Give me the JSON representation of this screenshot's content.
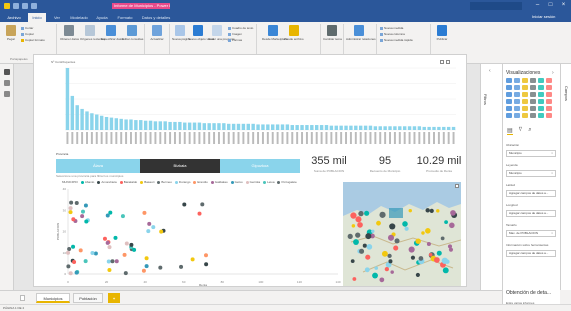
{
  "window": {
    "title": "Informe de Municipios - Power BI Desktop"
  },
  "ribbon_tabs": [
    {
      "label": "Archivo"
    },
    {
      "label": "Inicio"
    },
    {
      "label": "Ver"
    },
    {
      "label": "Modelado"
    },
    {
      "label": "Ayuda"
    },
    {
      "label": "Formato"
    },
    {
      "label": "Datos y detalles"
    }
  ],
  "signin": "Iniciar sesión",
  "ribbon": {
    "pegar": "Pegar",
    "cortar": "Cortar",
    "copiar": "Copiar",
    "copiar_formato": "Copiar formato",
    "obtener_datos": "Obtener datos",
    "origenes_recientes": "Orígenes recientes",
    "especificar_datos": "Especificar datos",
    "editar_consultas": "Editar consultas",
    "actualizar": "Actualizar",
    "nueva_pagina": "Nueva página",
    "nuevo_objeto": "Nuevo objeto visual",
    "hacer_pregunta": "Hacer una pregunta",
    "cuadro_texto": "Cuadro de texto",
    "imagen": "Imagen",
    "formas": "Formas",
    "desde_marketplace": "Desde Marketplace",
    "desde_archivo": "Desde archivo",
    "cambiar_tema": "Cambiar tema",
    "administrar_relaciones": "Administrar relaciones",
    "nueva_medida": "Nueva medida",
    "nueva_columna": "Nueva columna",
    "nueva_medida_rapida": "Nueva medida rápida",
    "publicar": "Publicar",
    "groups": {
      "portapapeles": "Portapapeles",
      "datos_externos": "Datos externos",
      "insertar": "Insertar",
      "objetos_personalizados": "Objetos visuales personalizados",
      "temas": "Temas",
      "relaciones": "Relaciones",
      "calculos": "Cálculos",
      "compartir": "Compartir"
    }
  },
  "bar_chart": {
    "title": "Nº Contribuyentes"
  },
  "chart_data": {
    "type": "bar",
    "categories_count": 80,
    "values": [
      100,
      55,
      40,
      34,
      30,
      27,
      25,
      23,
      21,
      20,
      19,
      18,
      17,
      17,
      16,
      16,
      15,
      15,
      14,
      14,
      14,
      13,
      13,
      13,
      12,
      12,
      12,
      12,
      11,
      11,
      11,
      11,
      11,
      10,
      10,
      10,
      10,
      10,
      10,
      9,
      9,
      9,
      9,
      9,
      9,
      9,
      8,
      8,
      8,
      8,
      8,
      8,
      8,
      8,
      7,
      7,
      7,
      7,
      7,
      7,
      7,
      7,
      7,
      6,
      6,
      6,
      6,
      6,
      6,
      6,
      6,
      6,
      6,
      5,
      5,
      5,
      5,
      5,
      5,
      5
    ],
    "ylim": [
      0,
      100
    ]
  },
  "slicer": {
    "title": "Provincia",
    "buttons": [
      "Álava",
      "Bizkaia",
      "Gipuzkoa"
    ],
    "selected": 1,
    "hint": "Seleccione una provincia para filtrar los municipios"
  },
  "kpis": [
    {
      "value": "355 mil",
      "caption": "Suma de POBLACION"
    },
    {
      "value": "95",
      "caption": "Recuento de Municipio"
    },
    {
      "value": "10.29 mil",
      "caption": "Promedio de Renta"
    }
  ],
  "scatter": {
    "legend_title": "MUNICIPIO",
    "legend": [
      {
        "name": "Abanto",
        "color": "#01b8aa"
      },
      {
        "name": "Amorebieta",
        "color": "#374649"
      },
      {
        "name": "Barakaldo",
        "color": "#fd625e"
      },
      {
        "name": "Basauri",
        "color": "#f2c80f"
      },
      {
        "name": "Bermeo",
        "color": "#5f6b6d"
      },
      {
        "name": "Durango",
        "color": "#8ad4eb"
      },
      {
        "name": "Erandio",
        "color": "#fe9666"
      },
      {
        "name": "Galdakao",
        "color": "#a66999"
      },
      {
        "name": "Getxo",
        "color": "#3599b8"
      },
      {
        "name": "Gernika",
        "color": "#dfbfbf"
      },
      {
        "name": "Leioa",
        "color": "#4ac5bb"
      },
      {
        "name": "Portugalete",
        "color": "#5f6b6d"
      }
    ],
    "xlabel": "Renta",
    "ylabel": "POBLACION",
    "x_ticks": [
      "0",
      "20",
      "40",
      "60",
      "80",
      "100",
      "120",
      "140"
    ],
    "y_ticks": [
      "0",
      "10",
      "20",
      "30",
      "40"
    ]
  },
  "viz_pane": {
    "title": "Visualizaciones",
    "wells": [
      {
        "label": "Ubicación",
        "value": "Municipio"
      },
      {
        "label": "Leyenda",
        "value": "Municipio"
      },
      {
        "label": "Latitud",
        "value": "Agregar campos de datos a..."
      },
      {
        "label": "Longitud",
        "value": "Agregar campos de datos a..."
      },
      {
        "label": "Tamaño",
        "value": "Max. de POBLACION"
      },
      {
        "label": "Información sobre herramientas",
        "value": "Agregar campos de datos a..."
      }
    ],
    "drill_title": "Obtención de deta...",
    "drill_sub": "Entre varios informes"
  },
  "filters_label": "Filtros",
  "fields_label": "Campos",
  "pages": [
    {
      "label": "Municipios",
      "active": true
    },
    {
      "label": "Población",
      "active": false
    }
  ],
  "add_page": "+",
  "status": "PÁGINA 1 DE 2"
}
